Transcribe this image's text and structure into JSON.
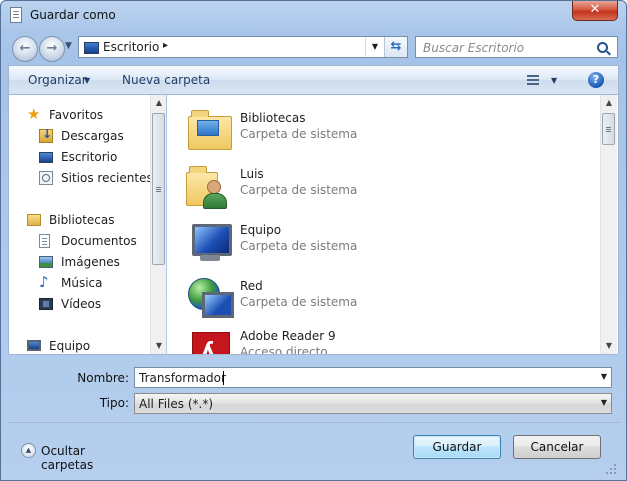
{
  "window": {
    "title": "Guardar como",
    "close_label": "✕"
  },
  "address_bar": {
    "location": "Escritorio",
    "separator": "▸",
    "dropdown": "▼",
    "refresh": "⇆"
  },
  "search": {
    "placeholder": "Buscar Escritorio"
  },
  "toolbar": {
    "organize": "Organizar",
    "organize_arrow": "▼",
    "new_folder": "Nueva carpeta",
    "views_arrow": "▼",
    "help": "?"
  },
  "nav": {
    "favorites": {
      "title": "Favoritos",
      "items": [
        {
          "label": "Descargas",
          "icon": "downloads-icon"
        },
        {
          "label": "Escritorio",
          "icon": "desktop-icon"
        },
        {
          "label": "Sitios recientes",
          "icon": "recent-places-icon"
        }
      ]
    },
    "libraries": {
      "title": "Bibliotecas",
      "items": [
        {
          "label": "Documentos",
          "icon": "documents-icon"
        },
        {
          "label": "Imágenes",
          "icon": "pictures-icon"
        },
        {
          "label": "Música",
          "icon": "music-icon"
        },
        {
          "label": "Vídeos",
          "icon": "videos-icon"
        }
      ]
    },
    "computer": {
      "title": "Equipo"
    }
  },
  "files": [
    {
      "name": "Bibliotecas",
      "type": "Carpeta de sistema",
      "icon": "libraries-folder-icon"
    },
    {
      "name": "Luis",
      "type": "Carpeta de sistema",
      "icon": "user-folder-icon"
    },
    {
      "name": "Equipo",
      "type": "Carpeta de sistema",
      "icon": "computer-icon"
    },
    {
      "name": "Red",
      "type": "Carpeta de sistema",
      "icon": "network-icon"
    },
    {
      "name": "Adobe Reader 9",
      "type": "Acceso directo",
      "icon": "pdf-shortcut-icon"
    }
  ],
  "form": {
    "filename_label": "Nombre:",
    "filename_value": "Transformador",
    "filetype_label": "Tipo:",
    "filetype_value": "All Files (*.*)",
    "dropdown_arrow": "▼"
  },
  "footer": {
    "hide_folders": "Ocultar carpetas",
    "save": "Guardar",
    "cancel": "Cancelar"
  },
  "scroll": {
    "up": "▲",
    "down": "▼"
  },
  "colors": {
    "frame": "#a9c6ea",
    "accent": "#3c7fb1",
    "close": "#c2311a"
  }
}
